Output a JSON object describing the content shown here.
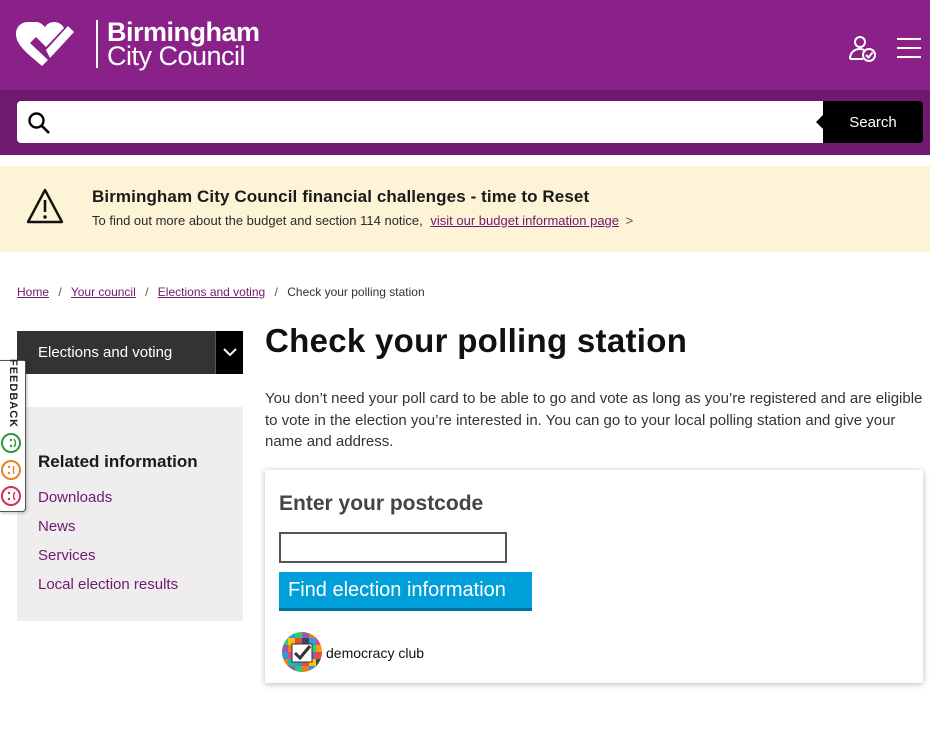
{
  "header": {
    "logo_line1": "Birmingham",
    "logo_line2": "City Council",
    "brand_color": "#8a2189",
    "account_icon": "account-check-icon",
    "menu_icon": "hamburger-menu-icon"
  },
  "search": {
    "placeholder": "",
    "value": "",
    "button_label": "Search"
  },
  "alert": {
    "icon": "warning-triangle-icon",
    "title": "Birmingham City Council financial challenges - time to Reset",
    "text": "To find out more about the budget and section 114 notice,",
    "link_text": "visit our budget information page",
    "link_suffix": ">"
  },
  "breadcrumb": {
    "items": [
      "Home",
      "Your council",
      "Elections and voting"
    ],
    "current": "Check your polling station",
    "separator": "/"
  },
  "sidebar": {
    "section_label": "Elections and voting",
    "related_heading": "Related information",
    "related_links": [
      "Downloads",
      "News",
      "Services",
      "Local election results"
    ]
  },
  "feedback": {
    "label": "FEEDBACK",
    "faces": [
      "happy-face-icon",
      "neutral-face-icon",
      "sad-face-icon"
    ]
  },
  "main": {
    "title": "Check your polling station",
    "intro": "You don’t need your poll card to be able to go and vote as long as you’re registered and are eligible to vote in the election you’re interested in.  You can go to your local polling station and give your name and address."
  },
  "widget": {
    "heading": "Enter your postcode",
    "postcode_value": "",
    "button_label": "Find election information",
    "powered_by": "democracy club",
    "button_color": "#009fd9"
  }
}
